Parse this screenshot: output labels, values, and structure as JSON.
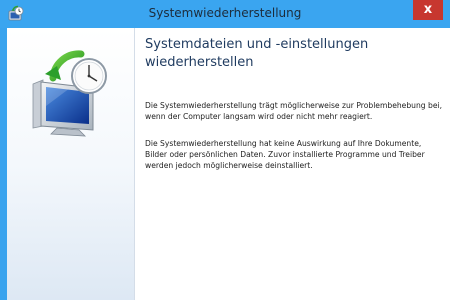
{
  "window": {
    "title": "Systemwiederherstellung",
    "close_label": "x"
  },
  "icons": {
    "app": "system-restore-icon",
    "hero": "system-restore-monitor-clock-icon"
  },
  "content": {
    "heading": "Systemdateien und -einstellungen wiederherstellen",
    "paragraph1": "Die Systemwiederherstellung trägt möglicherweise zur Problembehebung bei, wenn der Computer langsam wird oder nicht mehr reagiert.",
    "paragraph2": "Die Systemwiederherstellung hat keine Auswirkung auf Ihre Dokumente, Bilder oder persönlichen Daten. Zuvor installierte Programme und Treiber werden jedoch möglicherweise deinstalliert."
  },
  "colors": {
    "titlebar": "#3aa5f0",
    "close": "#c7372f",
    "heading": "#1e3a5f"
  }
}
